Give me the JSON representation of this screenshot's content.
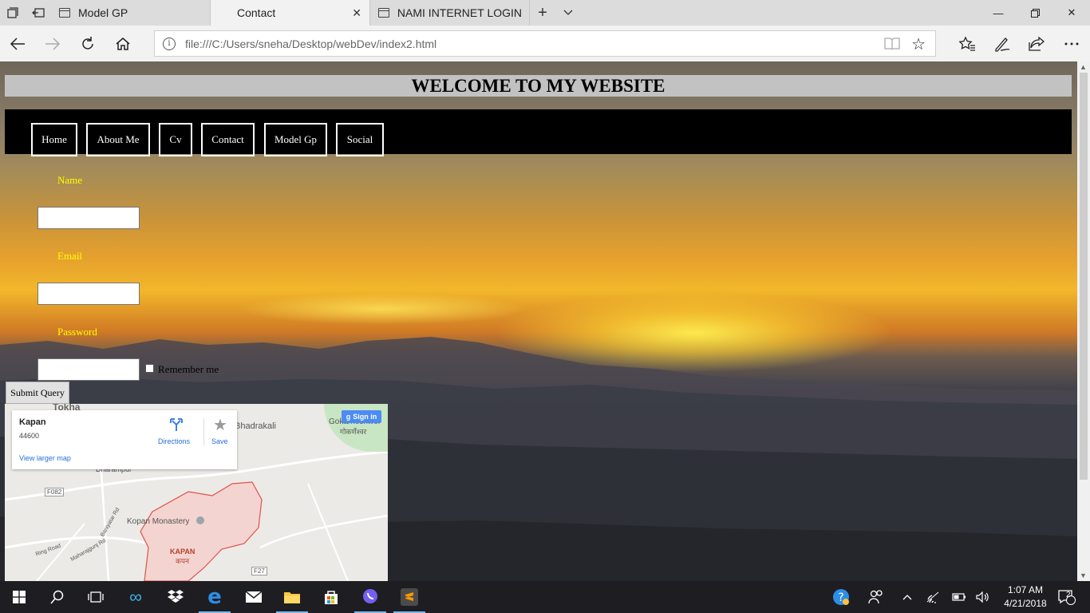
{
  "browser": {
    "tabs": [
      {
        "label": "Model GP",
        "active": false
      },
      {
        "label": "Contact",
        "active": true
      },
      {
        "label": "NAMI INTERNET LOGIN",
        "active": false
      }
    ],
    "url": "file:///C:/Users/sneha/Desktop/webDev/index2.html"
  },
  "page": {
    "header": "WELCOME TO MY WEBSITE",
    "menu": [
      "Home",
      "About Me",
      "Cv",
      "Contact",
      "Model Gp",
      "Social"
    ],
    "form": {
      "name_label": "Name",
      "email_label": "Email",
      "password_label": "Password",
      "remember_label": "Remember me",
      "submit_label": "Submit Query"
    },
    "map": {
      "place_title": "Kapan",
      "postal_code": "44600",
      "directions_label": "Directions",
      "save_label": "Save",
      "larger_map_label": "View larger map",
      "signin_label": "Sign in",
      "labels": {
        "tokha": "Tokha",
        "gokarneshwor": "Gokarneshwor",
        "gokarneshwor_np": "गोकर्णेश्वर",
        "bhadrakali": "Bhadrakali",
        "dharampur": "Dharampur",
        "road_f082": "F082",
        "kopan_monastery": "Kopan Monastery",
        "kapan": "KAPAN",
        "kapan_np": "कपन",
        "ring_road": "Ring Road",
        "baniyatar_rd": "Baniyatar Rd",
        "maharajgunj_rd": "Maharajgunj Rd",
        "road_f27": "F27"
      },
      "colors": {
        "boundary": "#e0514a",
        "area_fill": "#f4d4d0",
        "park": "#c8e6c4"
      }
    }
  },
  "taskbar": {
    "time": "1:07 AM",
    "date": "4/21/2018",
    "notification_count": "2"
  },
  "colors": {
    "menu_bg": "#000000",
    "header_bg": "#c2c2c2",
    "label_color": "#ffff00"
  }
}
